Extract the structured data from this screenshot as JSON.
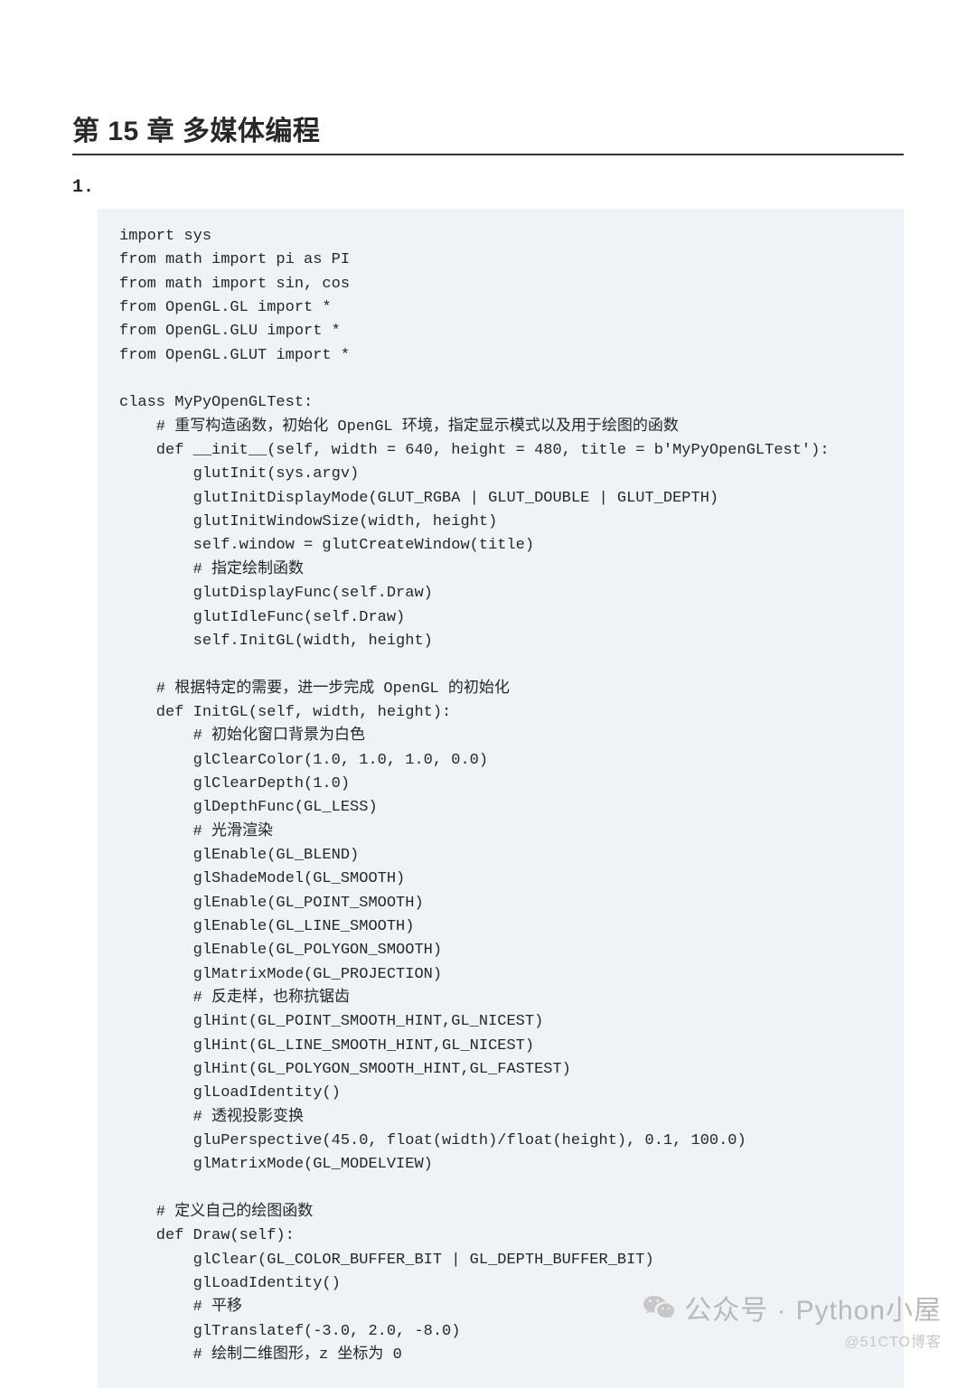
{
  "chapter": {
    "title": "第 15 章    多媒体编程"
  },
  "question": {
    "number": "1."
  },
  "code": {
    "lines": [
      "import sys",
      "from math import pi as PI",
      "from math import sin, cos",
      "from OpenGL.GL import *",
      "from OpenGL.GLU import *",
      "from OpenGL.GLUT import *",
      "",
      "class MyPyOpenGLTest:",
      "    # 重写构造函数，初始化 OpenGL 环境，指定显示模式以及用于绘图的函数",
      "    def __init__(self, width = 640, height = 480, title = b'MyPyOpenGLTest'):",
      "        glutInit(sys.argv)",
      "        glutInitDisplayMode(GLUT_RGBA | GLUT_DOUBLE | GLUT_DEPTH)",
      "        glutInitWindowSize(width, height)",
      "        self.window = glutCreateWindow(title)",
      "        # 指定绘制函数",
      "        glutDisplayFunc(self.Draw)",
      "        glutIdleFunc(self.Draw)",
      "        self.InitGL(width, height)",
      "",
      "    # 根据特定的需要，进一步完成 OpenGL 的初始化",
      "    def InitGL(self, width, height):",
      "        # 初始化窗口背景为白色",
      "        glClearColor(1.0, 1.0, 1.0, 0.0)",
      "        glClearDepth(1.0)",
      "        glDepthFunc(GL_LESS)",
      "        # 光滑渲染",
      "        glEnable(GL_BLEND)",
      "        glShadeModel(GL_SMOOTH)",
      "        glEnable(GL_POINT_SMOOTH)",
      "        glEnable(GL_LINE_SMOOTH)",
      "        glEnable(GL_POLYGON_SMOOTH)",
      "        glMatrixMode(GL_PROJECTION)",
      "        # 反走样，也称抗锯齿",
      "        glHint(GL_POINT_SMOOTH_HINT,GL_NICEST)",
      "        glHint(GL_LINE_SMOOTH_HINT,GL_NICEST)",
      "        glHint(GL_POLYGON_SMOOTH_HINT,GL_FASTEST)",
      "        glLoadIdentity()",
      "        # 透视投影变换",
      "        gluPerspective(45.0, float(width)/float(height), 0.1, 100.0)",
      "        glMatrixMode(GL_MODELVIEW)",
      "",
      "    # 定义自己的绘图函数",
      "    def Draw(self):",
      "        glClear(GL_COLOR_BUFFER_BIT | GL_DEPTH_BUFFER_BIT)",
      "        glLoadIdentity()",
      "        # 平移",
      "        glTranslatef(-3.0, 2.0, -8.0)",
      "        # 绘制二维图形，z 坐标为 0"
    ]
  },
  "watermark": {
    "prefix": "公众号 ·",
    "name": "Python小屋",
    "sub": "@51CTO博客"
  }
}
